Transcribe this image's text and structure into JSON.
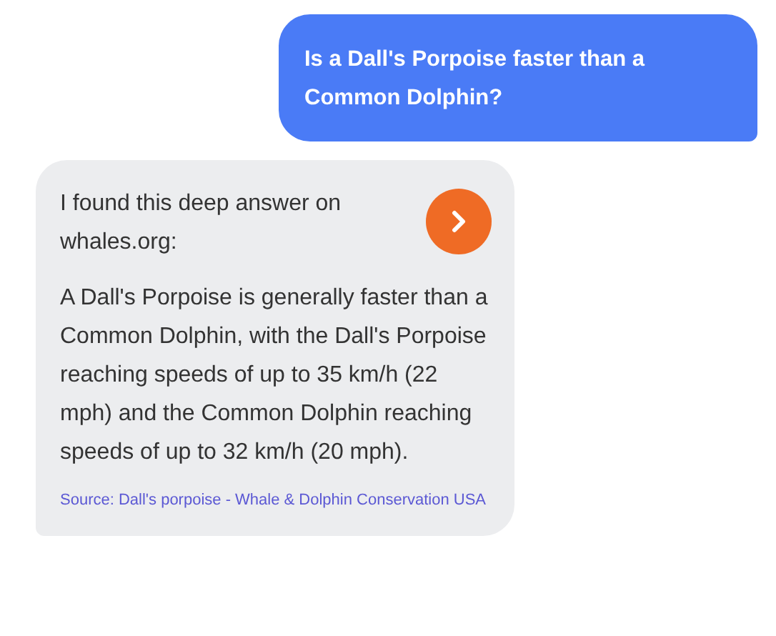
{
  "messages": [
    {
      "kind": "user",
      "text": "Is a Dall's Porpoise faster than a Common Dolphin?"
    },
    {
      "kind": "bot",
      "intro": "I found this deep answer on whales.org:",
      "answer": "A Dall's Porpoise is generally faster than a Common Dolphin, with the Dall's Porpoise reaching speeds of up to 35 km/h (22 mph) and the Common Dolphin reaching speeds of up to 32 km/h (20 mph).",
      "source": "Source: Dall's porpoise - Whale & Dolphin Conservation USA"
    }
  ]
}
